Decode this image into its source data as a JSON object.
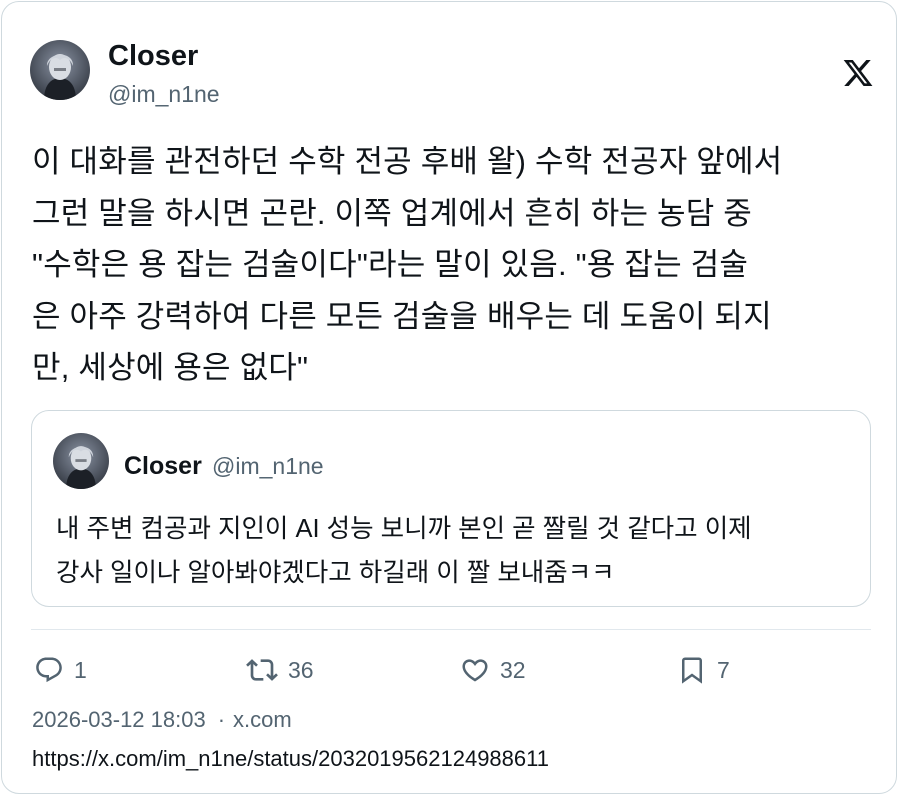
{
  "author": {
    "display_name": "Closer",
    "handle": "@im_n1ne"
  },
  "tweet": {
    "text": "이 대화를 관전하던 수학 전공 후배 왈) 수학 전공자 앞에서\n그런 말을 하시면 곤란. 이쪽 업계에서 흔히 하는 농담 중\n\"수학은 용 잡는 검술이다\"라는 말이 있음. \"용 잡는 검술\n은 아주 강력하여 다른 모든 검술을 배우는 데 도움이 되지\n만, 세상에 용은 없다\""
  },
  "quote": {
    "display_name": "Closer",
    "handle": "@im_n1ne",
    "text": "내 주변 컴공과 지인이 AI 성능 보니까 본인 곧 짤릴 것 같다고 이제\n강사 일이나 알아봐야겠다고 하길래 이 짤 보내줌ㅋㅋ"
  },
  "actions": {
    "replies": "1",
    "retweets": "36",
    "likes": "32",
    "bookmarks": "7"
  },
  "meta": {
    "timestamp": "2026-03-12 18:03",
    "separator": "·",
    "source": "x.com",
    "url": "https://x.com/im_n1ne/status/2032019562124988611"
  },
  "icons": {
    "brand": "x-logo-icon",
    "reply": "reply-icon",
    "retweet": "retweet-icon",
    "like": "heart-icon",
    "bookmark": "bookmark-icon"
  },
  "colors": {
    "text": "#0f1419",
    "secondary": "#536471",
    "border": "#cfd9de"
  }
}
